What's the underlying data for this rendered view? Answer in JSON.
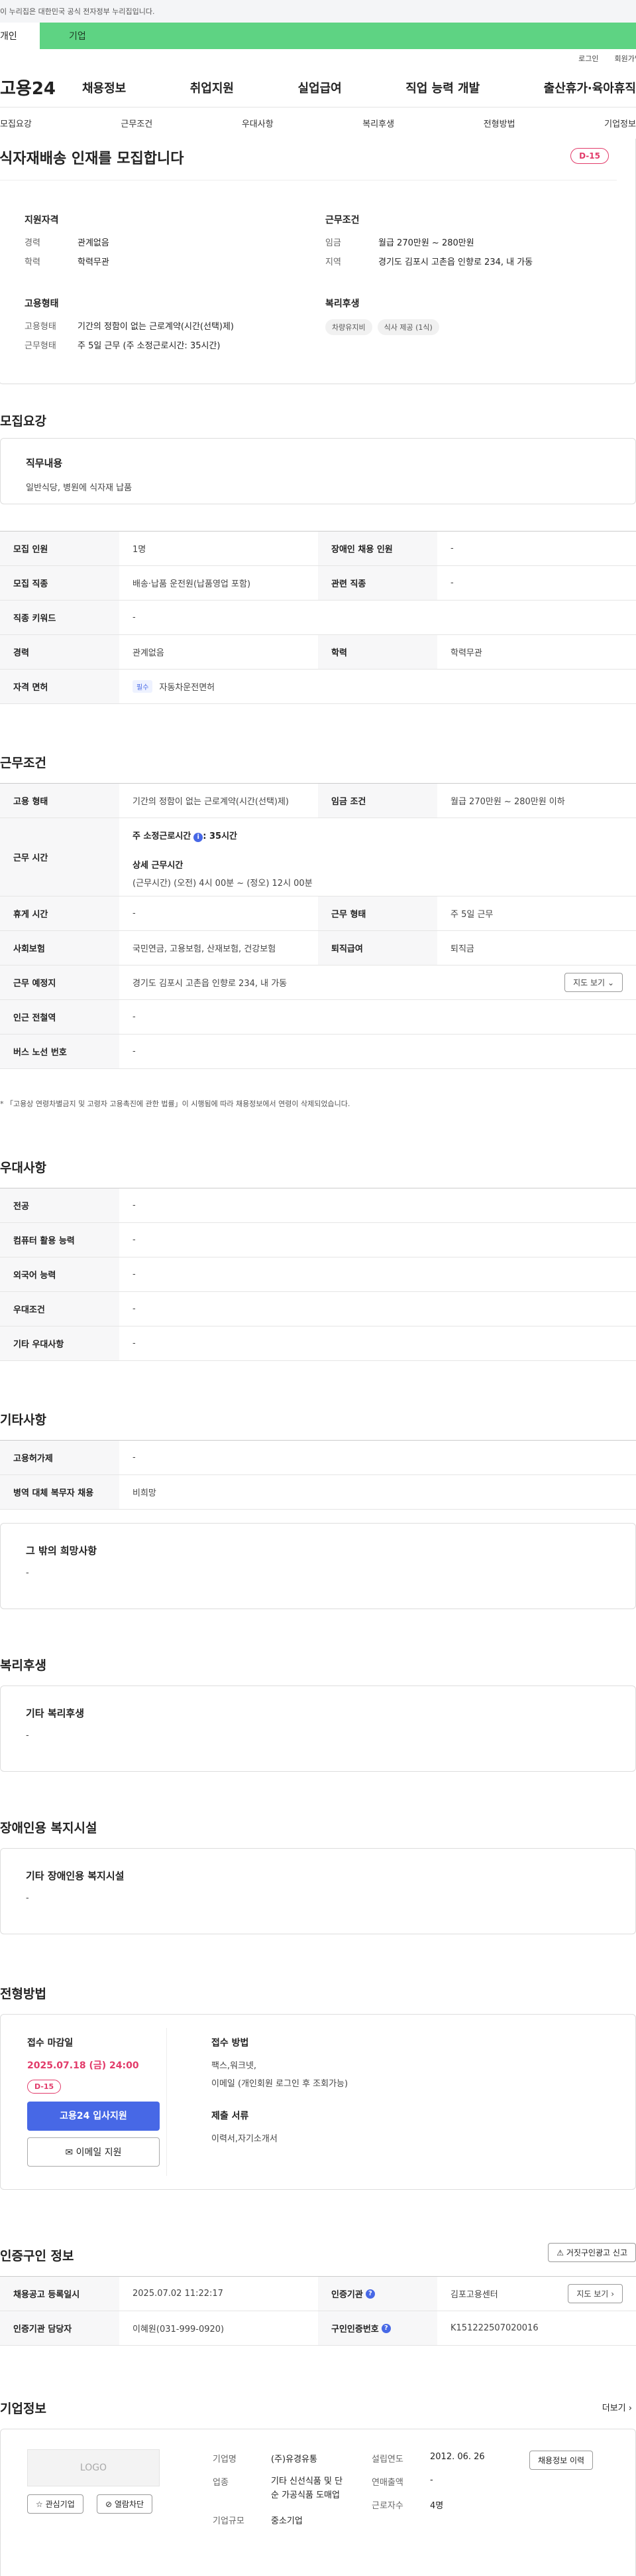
{
  "gov_banner": "이 누리집은 대한민국 공식 전자정부 누리집입니다.",
  "user_tabs": [
    "개인",
    "기업"
  ],
  "util": [
    "로그인",
    "회원가입"
  ],
  "logo": "고용24",
  "gnb": [
    "채용정보",
    "취업지원",
    "실업급여",
    "직업 능력 개발",
    "출산휴가·육아휴직"
  ],
  "subnav": [
    "모집요강",
    "근무조건",
    "우대사항",
    "복리후생",
    "전형방법",
    "기업정보"
  ],
  "hero": {
    "title": "식자재배송 인재를 모집합니다",
    "dday": "D-15",
    "qual_title": "지원자격",
    "qual": [
      {
        "k": "경력",
        "v": "관계없음"
      },
      {
        "k": "학력",
        "v": "학력무관"
      }
    ],
    "cond_title": "근무조건",
    "cond": [
      {
        "k": "임금",
        "v": "월급 270만원 ~ 280만원"
      },
      {
        "k": "지역",
        "v": "경기도 김포시 고촌읍 인향로 234, 내 가동"
      }
    ],
    "emp_title": "고용형태",
    "emp": [
      {
        "k": "고용형태",
        "v": "기간의 정함이 없는 근로계약(시간(선택)제)"
      },
      {
        "k": "근무형태",
        "v": "주 5일 근무 (주 소정근로시간: 35시간)"
      }
    ],
    "welfare_title": "복리후생",
    "welfare_tags": [
      "차량유지비",
      "식사 제공 (1식)"
    ]
  },
  "recruit": {
    "title": "모집요강",
    "duty_label": "직무내용",
    "duty": "일반식당, 병원에 식자재 납품",
    "rows": [
      [
        "모집 인원",
        "1명",
        "장애인 채용 인원",
        "-"
      ],
      [
        "모집 직종",
        "배송·납품 운전원(납품영업 포함)",
        "관련 직종",
        "-"
      ],
      [
        "직종 키워드",
        "-"
      ],
      [
        "경력",
        "관계없음",
        "학력",
        "학력무관"
      ],
      [
        "자격 면허",
        "자동차운전면허"
      ]
    ],
    "license_chip": "필수"
  },
  "work": {
    "title": "근무조건",
    "emp_type_label": "고용 형태",
    "emp_type": "기간의 정함이 없는 근로계약(시간(선택)제)",
    "wage_label": "임금 조건",
    "wage": "월급 270만원 ~ 280만원 이하",
    "hours_label": "근무 시간",
    "hours_main": "주 소정근로시간",
    "hours_value": ": 35시간",
    "hours_detail_title": "상세 근무시간",
    "hours_detail": "(근무시간) (오전) 4시 00분 ~ (정오) 12시 00분",
    "rows": [
      [
        "휴게 시간",
        "-",
        "근무 형태",
        "주 5일 근무"
      ],
      [
        "사회보험",
        "국민연금, 고용보험, 산재보험, 건강보험",
        "퇴직급여",
        "퇴직금"
      ],
      [
        "근무 예정지",
        "경기도 김포시 고촌읍 인향로 234, 내 가동"
      ],
      [
        "인근 전철역",
        "-"
      ],
      [
        "버스 노선 번호",
        "-"
      ]
    ],
    "map_btn": "지도 보기",
    "note": "* 「고용상 연령차별금지 및 고령자 고용촉진에 관한 법률」이 시행됨에 따라 채용정보에서 연령이 삭제되었습니다."
  },
  "pref": {
    "title": "우대사항",
    "rows": [
      [
        "전공",
        "-"
      ],
      [
        "컴퓨터 활용 능력",
        "-"
      ],
      [
        "외국어 능력",
        "-"
      ],
      [
        "우대조건",
        "-"
      ],
      [
        "기타 우대사항",
        "-"
      ]
    ]
  },
  "etc": {
    "title": "기타사항",
    "rows": [
      [
        "고용허가제",
        "-"
      ],
      [
        "병역 대체 복무자 채용",
        "비희망"
      ]
    ],
    "hope_label": "그 밖의 희망사항",
    "hope": "-"
  },
  "benefit": {
    "title": "복리후생",
    "label": "기타 복리후생",
    "value": "-"
  },
  "facility": {
    "title": "장애인용 복지시설",
    "label": "기타 장애인용 복지시설",
    "value": "-"
  },
  "screening": {
    "title": "전형방법",
    "deadline_label": "접수 마감일",
    "deadline": "2025.07.18 (금) 24:00",
    "dday": "D-15",
    "apply_btn": "고용24 입사지원",
    "mail_btn": "이메일 지원",
    "method_label": "접수 방법",
    "method": "팩스,워크넷,",
    "method2": "이메일 (개인회원 로그인 후 조회가능)",
    "docs_label": "제출 서류",
    "docs": "이력서,자기소개서"
  },
  "cert": {
    "title": "인증구인 정보",
    "report_btn": "거짓구인광고 신고",
    "rows": [
      [
        "채용공고 등록일시",
        "2025.07.02 11:22:17",
        "인증기관",
        "김포고용센터"
      ],
      [
        "인증기관 담당자",
        "이혜원(031-999-0920)",
        "구인인증번호",
        "K151222507020016"
      ]
    ],
    "map_btn": "지도 보기"
  },
  "company": {
    "title": "기업정보",
    "more": "더보기",
    "logo_text": "LOGO",
    "fav_btn": "관심기업",
    "block_btn": "열람차단",
    "name_label": "기업명",
    "name": "(주)유경유통",
    "industry_label": "업종",
    "industry": "기타 신선식품 및 단순 가공식품 도매업",
    "size_label": "기업규모",
    "size": "중소기업",
    "founded_label": "설립연도",
    "founded": "2012. 06. 26",
    "sales_label": "연매출액",
    "sales": "-",
    "staff_label": "근로자수",
    "staff": "4명",
    "history_btn": "채용정보 이력"
  }
}
